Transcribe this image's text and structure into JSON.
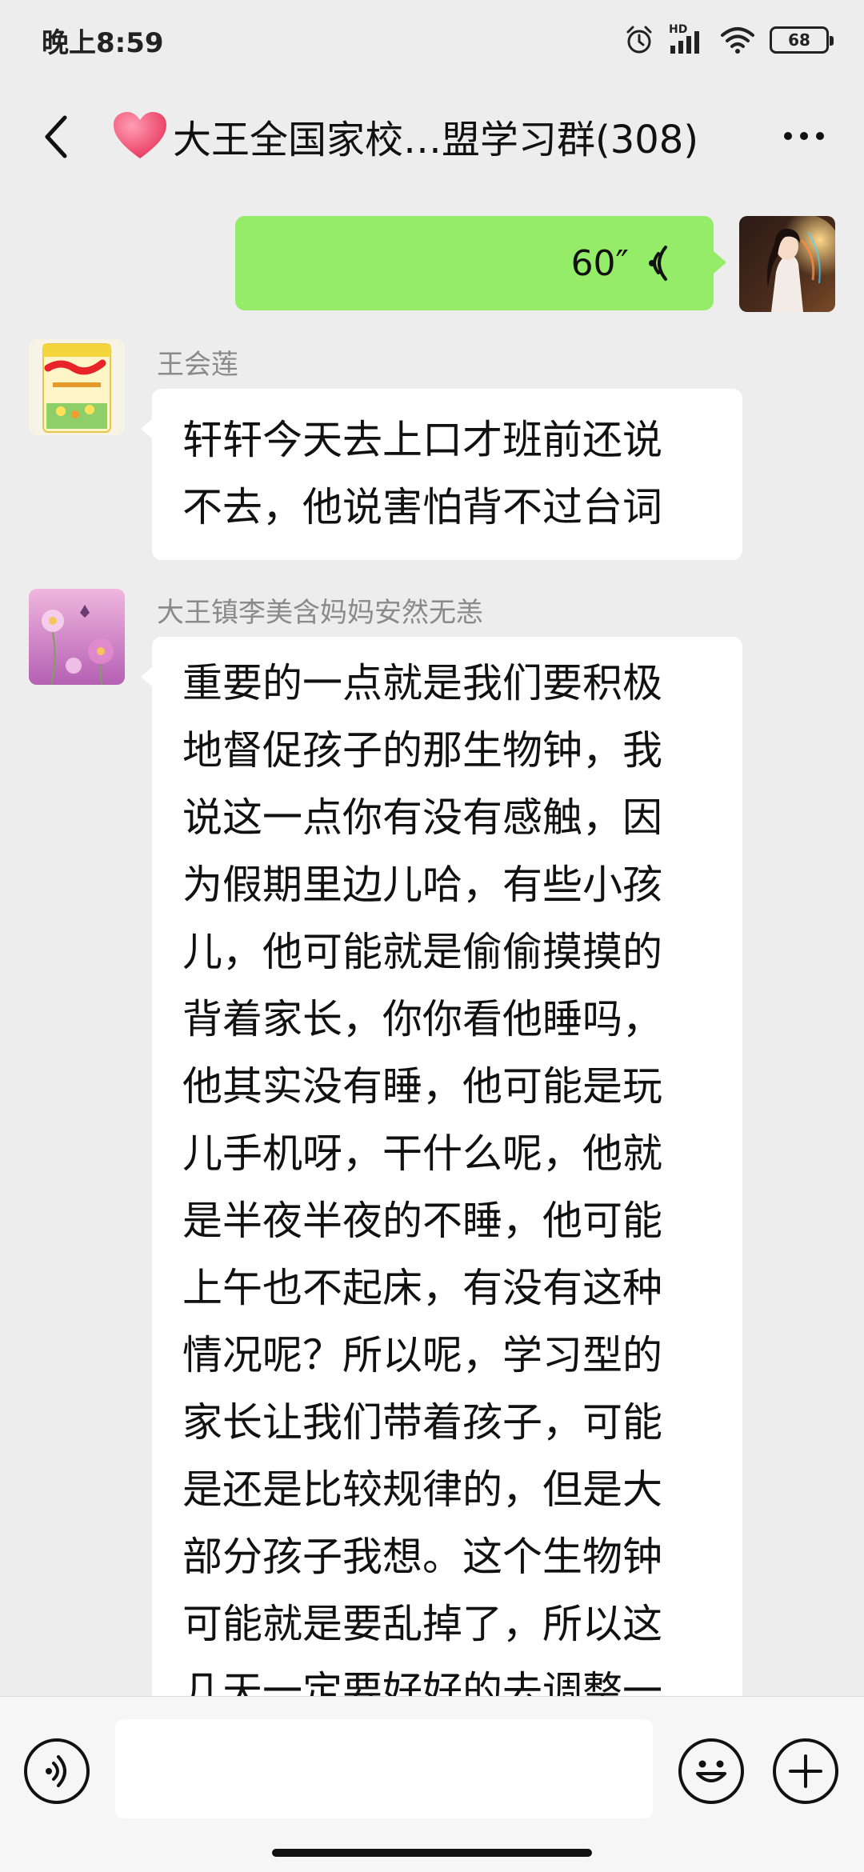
{
  "status_bar": {
    "time": "晚上8:59",
    "network_label": "HD",
    "battery": "68"
  },
  "header": {
    "title": "大王全国家校…盟学习群(308)",
    "heart_color": "#f0476b"
  },
  "messages": [
    {
      "type": "voice",
      "side": "right",
      "duration": "60″"
    },
    {
      "type": "text",
      "side": "left",
      "sender": "王会莲",
      "avatar_icon": "detergent-package-avatar",
      "lines": [
        "轩轩今天去上口才班前还说",
        "不去，他说害怕背不过台词"
      ]
    },
    {
      "type": "text",
      "side": "left",
      "sender": "大王镇李美含妈妈安然无恙",
      "avatar_icon": "pink-flower-avatar",
      "lines": [
        "重要的一点就是我们要积极",
        "地督促孩子的那生物钟，我",
        "说这一点你有没有感触，因",
        "为假期里边儿哈，有些小孩",
        "儿，他可能就是偷偷摸摸的",
        "背着家长，你你看他睡吗，",
        "他其实没有睡，他可能是玩",
        "儿手机呀，干什么呢，他就",
        "是半夜半夜的不睡，他可能",
        "上午也不起床，有没有这种",
        "情况呢？所以呢，学习型的",
        "家长让我们带着孩子，可能",
        "是还是比较规律的，但是大",
        "部分孩子我想。这个生物钟",
        "可能就是要乱掉了，所以这",
        "几天一定要好好的去调整一"
      ]
    }
  ],
  "input": {
    "value": ""
  },
  "colors": {
    "background": "#ededed",
    "voice_bubble": "#95ec69",
    "bubble": "#ffffff"
  }
}
